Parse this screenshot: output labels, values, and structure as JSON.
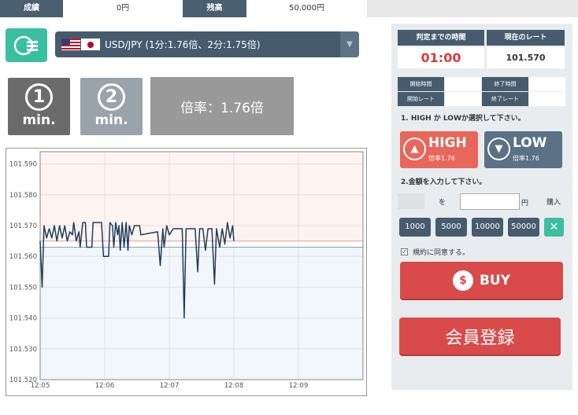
{
  "balance_bar": {
    "results_label": "成績",
    "results_value": "0円",
    "balance_label": "残高",
    "balance_value": "50,000円"
  },
  "currency": {
    "selected": "USD/JPY (1分:1.76倍、2分:1.75倍)"
  },
  "time_buttons": [
    {
      "number": "1",
      "unit": "min."
    },
    {
      "number": "2",
      "unit": "min."
    }
  ],
  "payout_display": "倍率：1.76倍",
  "status_table": {
    "time_to_judge_label": "判定までの時間",
    "current_rate_label": "現在のレート",
    "timer_value": "01:00",
    "current_rate_value": "101.570",
    "start_time_label": "開始時間",
    "end_time_label": "終了時間",
    "start_rate_label": "開始レート",
    "end_rate_label": "終了レート"
  },
  "step1_text": "1. HIGH か LOWか選択して下さい。",
  "high_button": {
    "label": "HIGH",
    "sub": "倍率1.76"
  },
  "low_button": {
    "label": "LOW",
    "sub": "倍率1.76"
  },
  "step2_text": "2.金額を入力して下さい。",
  "amount": {
    "wo_label": "を",
    "yen_label": "円",
    "purchase_label": "購入",
    "value": ""
  },
  "amount_buttons": [
    "1000",
    "5000",
    "10000",
    "50000"
  ],
  "clear_icon": "close-icon",
  "agree_text": "規約に同意する。",
  "buy_label": "BUY",
  "register_label": "会員登録",
  "colors": {
    "high": "#e8675a",
    "low": "#5b7185",
    "accent": "#3bbfa1",
    "buy": "#d94b4b"
  },
  "chart_data": {
    "type": "line",
    "title": "",
    "xlabel": "",
    "ylabel": "",
    "xlim": [
      "12:05",
      "12:10"
    ],
    "ylim": [
      101.52,
      101.594
    ],
    "y_ticks": [
      "101.590",
      "101.580",
      "101.570",
      "101.560",
      "101.550",
      "101.540",
      "101.530",
      "101.520"
    ],
    "x_ticks": [
      "12:05",
      "12:06",
      "12:07",
      "12:08",
      "12:09"
    ],
    "grid": true,
    "high_line": 101.565,
    "low_line": 101.563,
    "series": [
      {
        "x_min": [
          0,
          0.02,
          0.04,
          0.06,
          0.08,
          0.1,
          0.12,
          0.14,
          0.16,
          0.18,
          0.2,
          0.22,
          0.24,
          0.26,
          0.28,
          0.3,
          0.32,
          0.34,
          0.36,
          0.38,
          0.4,
          0.42,
          0.44,
          0.46,
          0.48,
          0.5,
          0.52,
          0.54,
          0.56,
          0.6,
          0.64,
          0.68,
          0.72,
          0.76,
          0.8,
          0.84,
          0.88,
          0.9,
          0.92,
          0.94,
          0.96,
          1.0,
          1.04,
          1.06,
          1.08,
          1.1,
          1.12,
          1.14,
          1.16,
          1.18,
          1.2,
          1.22,
          1.24,
          1.26,
          1.28,
          1.32,
          1.36,
          1.38,
          1.4,
          1.42,
          1.44,
          1.46,
          1.48,
          1.5,
          1.52,
          1.54,
          1.56,
          1.58,
          1.6,
          1.62,
          1.64,
          1.66,
          1.68,
          1.7,
          1.72,
          1.74,
          1.76,
          1.78,
          1.8,
          1.82,
          1.84,
          1.86,
          1.88,
          1.9,
          1.92,
          1.94,
          1.96,
          1.98,
          2.0,
          2.02,
          2.04,
          2.06,
          2.08,
          2.1,
          2.12,
          2.14,
          2.16,
          2.18,
          2.2,
          2.22,
          2.24,
          2.26,
          2.28,
          2.3,
          2.32,
          2.34,
          2.36,
          2.38,
          2.4,
          2.42,
          2.44,
          2.46,
          2.48,
          2.5,
          2.52,
          2.54,
          2.56,
          2.58,
          2.6,
          2.62,
          2.64,
          2.66,
          2.68,
          2.7,
          2.72,
          2.74,
          2.76,
          2.78,
          2.8,
          2.82,
          2.84,
          2.86,
          2.88,
          2.9,
          2.92,
          2.94,
          2.96,
          2.98,
          3.0,
          3.02,
          3.04,
          3.06,
          3.08,
          3.1,
          3.12,
          3.14,
          3.16,
          3.18,
          3.2,
          3.22,
          3.24,
          3.26,
          3.28,
          3.3,
          3.32,
          3.34,
          3.36,
          3.38,
          3.4,
          3.42,
          3.44,
          3.46,
          3.48,
          3.5,
          3.52,
          3.54,
          3.56,
          3.58,
          3.6
        ],
        "y": [
          101.565,
          101.55,
          101.57,
          101.567,
          101.565,
          101.57,
          101.568,
          101.566,
          101.57,
          101.567,
          101.571,
          101.565,
          101.57,
          101.568,
          101.567,
          101.571,
          101.566,
          101.569,
          101.567,
          101.571,
          101.565,
          101.563,
          101.565,
          101.565,
          101.563,
          101.571,
          101.571,
          101.57,
          101.571,
          101.571,
          101.571,
          101.571,
          101.571,
          101.571,
          101.571,
          101.571,
          101.571,
          101.571,
          101.56,
          101.56,
          101.56,
          101.56,
          101.571,
          101.571,
          101.563,
          101.571,
          101.567,
          101.57,
          101.56,
          101.571,
          101.565,
          101.57,
          101.562,
          101.571,
          101.567,
          101.568,
          101.563,
          101.57,
          101.562,
          101.57,
          101.568,
          101.568,
          101.57,
          101.57,
          101.57,
          101.57,
          101.57,
          101.57,
          101.57,
          101.567,
          101.567,
          101.567,
          101.567,
          101.567,
          101.567,
          101.567,
          101.567,
          101.567,
          101.567,
          101.567,
          101.567,
          101.567,
          101.567,
          101.567,
          101.567,
          101.567,
          101.567,
          101.567,
          101.567,
          101.567,
          101.567,
          101.567,
          101.567,
          101.567,
          101.567,
          101.567,
          101.567,
          101.567,
          101.567,
          101.567,
          101.567,
          101.567,
          101.567,
          101.567,
          101.567,
          101.567,
          101.567,
          101.567,
          101.567,
          101.567,
          101.567,
          101.567,
          101.567,
          101.567,
          101.567,
          101.567,
          101.567,
          101.567,
          101.567,
          101.567,
          101.567,
          101.567,
          101.567,
          101.567,
          101.567,
          101.567,
          101.567,
          101.567,
          101.567,
          101.567,
          101.567,
          101.567,
          101.567,
          101.567,
          101.567,
          101.567,
          101.567,
          101.567,
          101.567,
          101.567,
          101.567,
          101.567,
          101.567,
          101.567,
          101.567,
          101.567,
          101.567,
          101.567,
          101.567,
          101.567,
          101.567,
          101.567,
          101.567,
          101.567,
          101.567,
          101.567,
          101.567,
          101.567,
          101.567,
          101.567,
          101.567,
          101.567,
          101.567,
          101.567,
          101.567,
          101.567,
          101.567,
          101.567,
          101.567,
          101.567,
          101.567,
          101.567,
          101.567
        ]
      }
    ]
  }
}
